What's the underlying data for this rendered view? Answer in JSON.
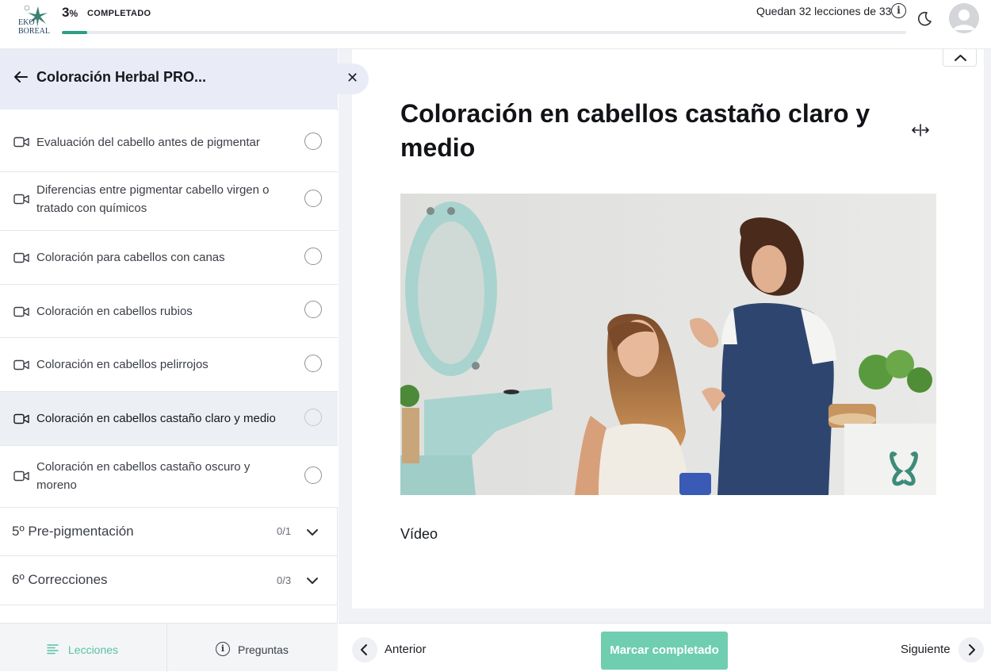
{
  "header": {
    "logo_text_top": "EKO",
    "logo_text_bottom": "BOREAL",
    "progress_percent_value": "3",
    "progress_percent_symbol": "%",
    "progress_label": "COMPLETADO",
    "progress_fraction": 0.03,
    "remaining_text": "Quedan 32 lecciones de 33",
    "info_icon_glyph": "i"
  },
  "sidebar": {
    "course_title": "Coloración Herbal PRO...",
    "close_glyph": "✕",
    "lessons": [
      {
        "title": "Evaluación del cabello antes de pigmentar",
        "active": false
      },
      {
        "title": "Diferencias entre pigmentar cabello virgen o tratado con químicos",
        "active": false
      },
      {
        "title": "Coloración para cabellos con canas",
        "active": false
      },
      {
        "title": "Coloración en cabellos rubios",
        "active": false
      },
      {
        "title": "Coloración en cabellos pelirrojos",
        "active": false
      },
      {
        "title": "Coloración en cabellos castaño claro y medio",
        "active": true
      },
      {
        "title": "Coloración en cabellos castaño oscuro y moreno",
        "active": false
      }
    ],
    "sections": [
      {
        "title": "5º Pre-pigmentación",
        "count": "0/1"
      },
      {
        "title": "6º Correcciones",
        "count": "0/3"
      }
    ],
    "tabs": {
      "lessons_label": "Lecciones",
      "questions_label": "Preguntas"
    }
  },
  "main": {
    "lesson_title": "Coloración en cabellos castaño claro y medio",
    "video_caption": "Vídeo"
  },
  "footer": {
    "prev_label": "Anterior",
    "mark_complete_label": "Marcar completado",
    "next_label": "Siguiente"
  },
  "colors": {
    "accent": "#58c2a3",
    "button": "#6fcdb0",
    "progress_fill": "#2f9e86",
    "sidebar_header_bg": "#e9ecf6"
  },
  "icons": [
    "arrow-left-icon",
    "close-icon",
    "video-camera-icon",
    "radio-circle-icon",
    "chevron-down-icon",
    "chevron-up-icon",
    "expand-horizontal-icon",
    "info-icon",
    "moon-icon",
    "user-avatar-icon",
    "list-icon",
    "chevron-left-icon",
    "chevron-right-icon"
  ]
}
